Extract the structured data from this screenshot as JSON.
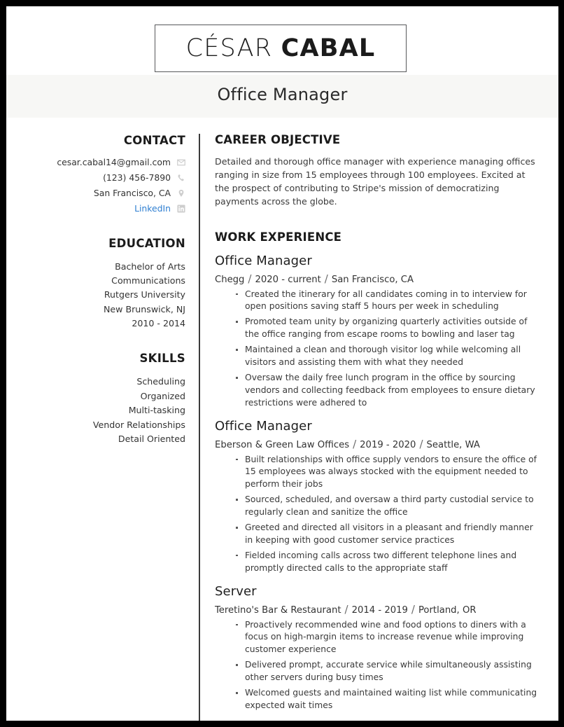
{
  "header": {
    "first_name": "CÉSAR",
    "last_name": "CABAL",
    "job_title": "Office Manager"
  },
  "sidebar": {
    "contact": {
      "heading": "CONTACT",
      "items": [
        {
          "text": "cesar.cabal14@gmail.com",
          "icon": "envelope-icon",
          "is_link": false
        },
        {
          "text": "(123) 456-7890",
          "icon": "phone-icon",
          "is_link": false
        },
        {
          "text": "San Francisco, CA",
          "icon": "map-pin-icon",
          "is_link": false
        },
        {
          "text": "LinkedIn",
          "icon": "linkedin-icon",
          "is_link": true
        }
      ]
    },
    "education": {
      "heading": "EDUCATION",
      "items": [
        "Bachelor of Arts",
        "Communications",
        "Rutgers University",
        "New Brunswick, NJ",
        "2010 - 2014"
      ]
    },
    "skills": {
      "heading": "SKILLS",
      "items": [
        "Scheduling",
        "Organized",
        "Multi-tasking",
        "Vendor Relationships",
        "Detail Oriented"
      ]
    }
  },
  "main": {
    "objective": {
      "heading": "CAREER OBJECTIVE",
      "text": "Detailed and thorough office manager with experience managing offices ranging in size from 15 employees through 100 employees. Excited at the prospect of contributing to Stripe's mission of democratizing payments across the globe."
    },
    "work": {
      "heading": "WORK EXPERIENCE",
      "jobs": [
        {
          "role": "Office Manager",
          "company": "Chegg",
          "dates": "2020 - current",
          "location": "San Francisco, CA",
          "bullets": [
            "Created the itinerary for all candidates coming in to interview for open positions saving staff 5 hours per week in scheduling",
            "Promoted team unity by organizing quarterly activities outside of the office ranging from escape rooms to bowling and laser tag",
            "Maintained a clean and thorough visitor log while welcoming all visitors and assisting them with what they needed",
            "Oversaw the daily free lunch program in the office by sourcing vendors and collecting feedback from employees to ensure dietary restrictions were adhered to"
          ]
        },
        {
          "role": "Office Manager",
          "company": "Eberson & Green Law Offices",
          "dates": "2019 - 2020",
          "location": "Seattle, WA",
          "bullets": [
            "Built relationships with office supply vendors to ensure the office of 15 employees was always stocked with the equipment needed to perform their jobs",
            "Sourced, scheduled, and oversaw a third party custodial service to regularly clean and sanitize the office",
            "Greeted and directed all visitors in a pleasant and friendly manner in keeping with good customer service practices",
            "Fielded incoming calls across two different telephone lines and promptly directed calls to the appropriate staff"
          ]
        },
        {
          "role": "Server",
          "company": "Teretino's Bar & Restaurant",
          "dates": "2014 - 2019",
          "location": "Portland, OR",
          "bullets": [
            "Proactively recommended wine and food options to diners with a focus on high-margin items to increase revenue while improving customer experience",
            "Delivered prompt, accurate service while simultaneously assisting other servers during busy times",
            "Welcomed guests and maintained waiting list while communicating expected wait times"
          ]
        }
      ],
      "separator": "/"
    }
  },
  "colors": {
    "link": "#2f7fd1",
    "text": "#333333",
    "heading": "#1b1b1b",
    "band": "#f7f7f5",
    "border": "#000000"
  }
}
